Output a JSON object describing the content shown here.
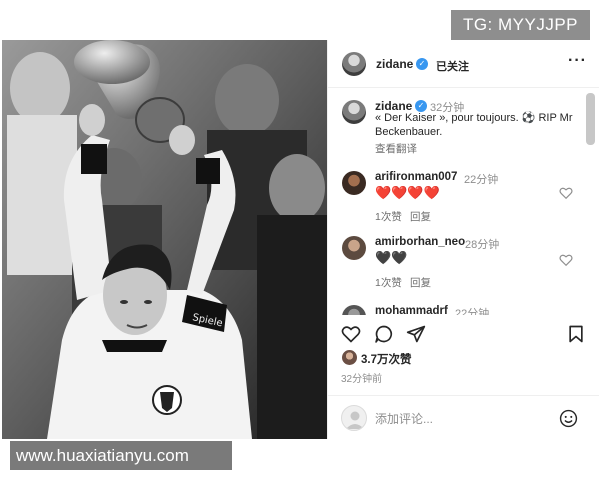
{
  "watermarks": {
    "top": "TG: MYYJJPP",
    "bottom": "www.huaxiatianyu.com"
  },
  "photo": {
    "shirt_text": "Spiele"
  },
  "post": {
    "header": {
      "username": "zidane",
      "follow_status": "已关注",
      "more_icon": "more-horizontal-icon"
    },
    "caption": {
      "username": "zidane",
      "time": "32分钟",
      "text": "« Der Kaiser », pour toujours. ⚽ RIP Mr Beckenbauer.",
      "translate_label": "查看翻译"
    },
    "comments": [
      {
        "username": "arifironman007",
        "time": "22分钟",
        "text": "❤️❤️❤️❤️",
        "likes": "1次赞",
        "reply": "回复"
      },
      {
        "username": "amirborhan_neo",
        "time": "28分钟",
        "text": "🖤🖤",
        "likes": "1次赞",
        "reply": "回复"
      },
      {
        "username": "mohammadrf",
        "time": "22分钟"
      }
    ],
    "likes_count": "3.7万次赞",
    "posted_ago": "32分钟前",
    "add_comment_placeholder": "添加评论...",
    "colors": {
      "verified": "#3897f0",
      "heart_red": "#e0245e",
      "muted_text": "#8e8e8e",
      "divider": "#efefef"
    }
  }
}
